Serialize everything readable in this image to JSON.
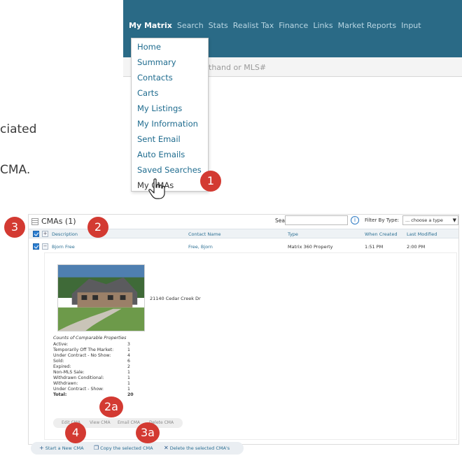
{
  "side_text": {
    "line1": "ciated",
    "line2": "CMA."
  },
  "nav": {
    "items": [
      "My Matrix",
      "Search",
      "Stats",
      "Realist Tax",
      "Finance",
      "Links",
      "Market Reports",
      "Input"
    ],
    "search_placeholder": "thand or MLS#"
  },
  "menu": {
    "items": [
      "Home",
      "Summary",
      "Contacts",
      "Carts",
      "My Listings",
      "My Information",
      "Sent Email",
      "Auto Emails",
      "Saved Searches",
      "My CMAs"
    ]
  },
  "callouts": {
    "c1": "1",
    "c2": "2",
    "c2a": "2a",
    "c3": "3",
    "c3a": "3a",
    "c4": "4"
  },
  "panel": {
    "title": "CMAs (1)",
    "search_label": "Search:",
    "filter_label": "Filter By Type:",
    "filter_value": "... choose a type",
    "columns": [
      "Description",
      "Contact Name",
      "Type",
      "When Created",
      "Last Modified"
    ],
    "row": {
      "description": "Bjorn Free",
      "contact": "Free, Bjorn",
      "type": "Matrix 360 Property",
      "created": "1:51 PM",
      "modified": "2:00 PM"
    },
    "detail": {
      "address": "21140 Cedar Creek Dr",
      "counts_title": "Counts of Comparable Properties",
      "counts": [
        {
          "label": "Active:",
          "value": "3"
        },
        {
          "label": "Temporarily Off The Market:",
          "value": "1"
        },
        {
          "label": "Under Contract - No Show:",
          "value": "4"
        },
        {
          "label": "Sold:",
          "value": "6"
        },
        {
          "label": "Expired:",
          "value": "2"
        },
        {
          "label": "Non-MLS Sale:",
          "value": "1"
        },
        {
          "label": "Withdrawn Conditional:",
          "value": "1"
        },
        {
          "label": "Withdrawn:",
          "value": "1"
        },
        {
          "label": "Under Contract - Show:",
          "value": "1"
        },
        {
          "label": "Total:",
          "value": "20"
        }
      ],
      "actions": [
        "Edit CMA",
        "View CMA",
        "Email CMA",
        "Delete CMA"
      ]
    }
  },
  "bottom": {
    "start_new": "Start a New CMA",
    "copy": "Copy the selected CMA",
    "delete": "Delete the selected CMA's"
  },
  "colors": {
    "nav_bg": "#2a6a86",
    "callout": "#d33a32",
    "link": "#1e6b8e",
    "checkbox": "#2b7ed1"
  }
}
